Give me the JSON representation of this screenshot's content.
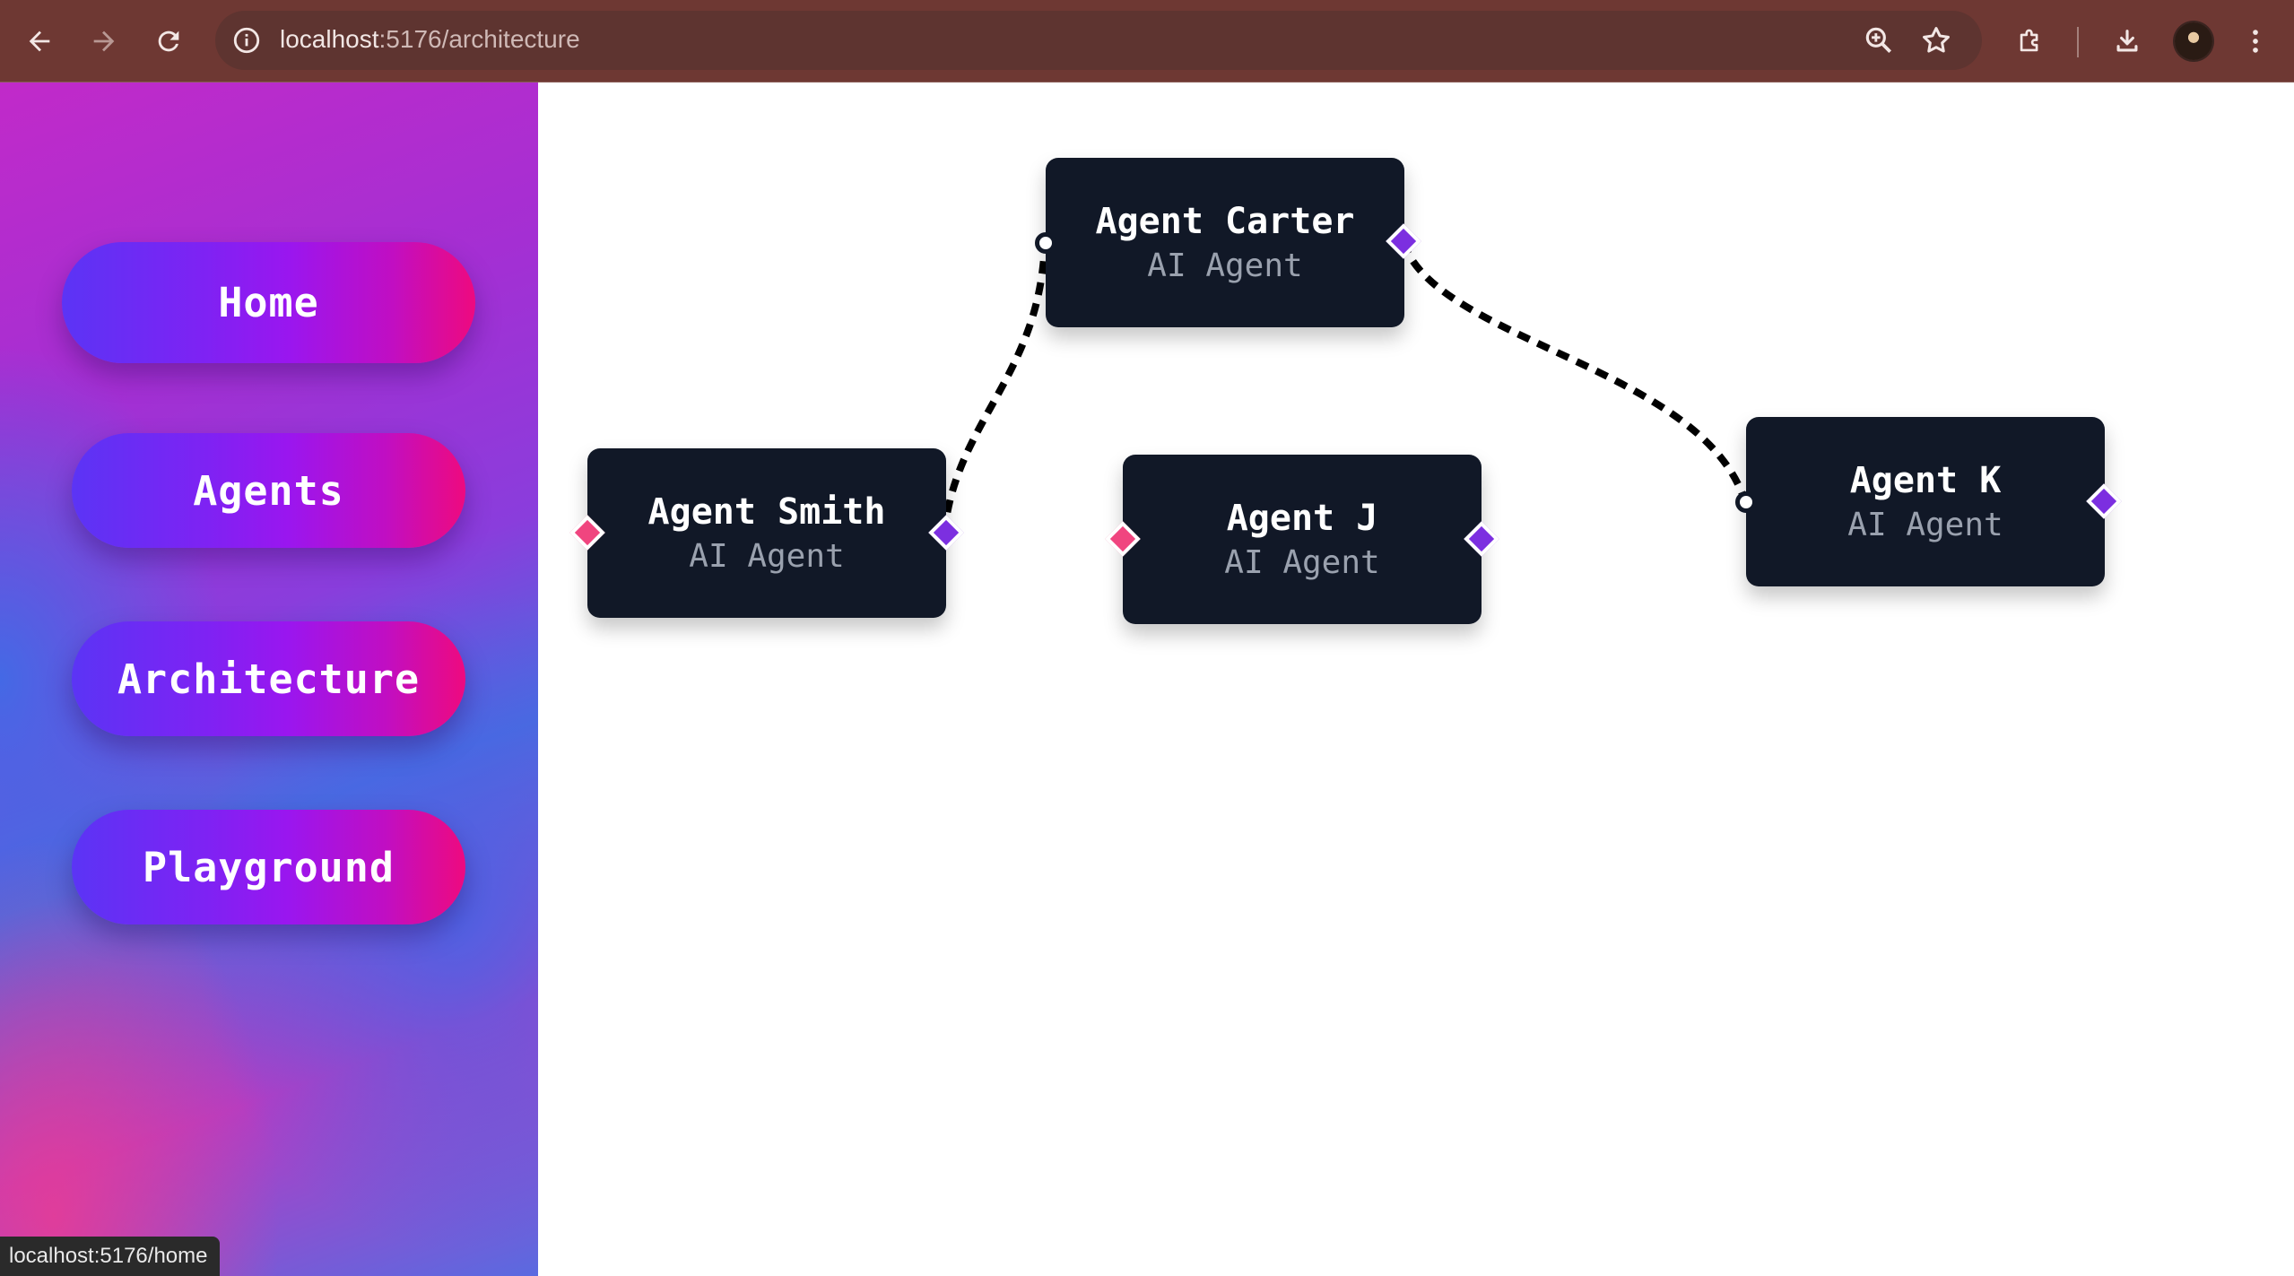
{
  "browser": {
    "url_host": "localhost",
    "url_path": ":5176/architecture",
    "status_url": "localhost:5176/home"
  },
  "sidebar": {
    "items": [
      {
        "label": "Home"
      },
      {
        "label": "Agents"
      },
      {
        "label": "Architecture"
      },
      {
        "label": "Playground"
      }
    ]
  },
  "canvas": {
    "nodes": [
      {
        "title": "Agent Carter",
        "subtitle": "AI Agent"
      },
      {
        "title": "Agent Smith",
        "subtitle": "AI Agent"
      },
      {
        "title": "Agent J",
        "subtitle": "AI Agent"
      },
      {
        "title": "Agent K",
        "subtitle": "AI Agent"
      }
    ],
    "edges": [
      {
        "from": "Agent Smith",
        "to": "Agent Carter"
      },
      {
        "from": "Agent Carter",
        "to": "Agent K"
      }
    ],
    "edge_color": "#000000"
  },
  "colors": {
    "input_handle": "#f0457f",
    "output_handle": "#7c2fe0",
    "node_bg": "#111827"
  }
}
